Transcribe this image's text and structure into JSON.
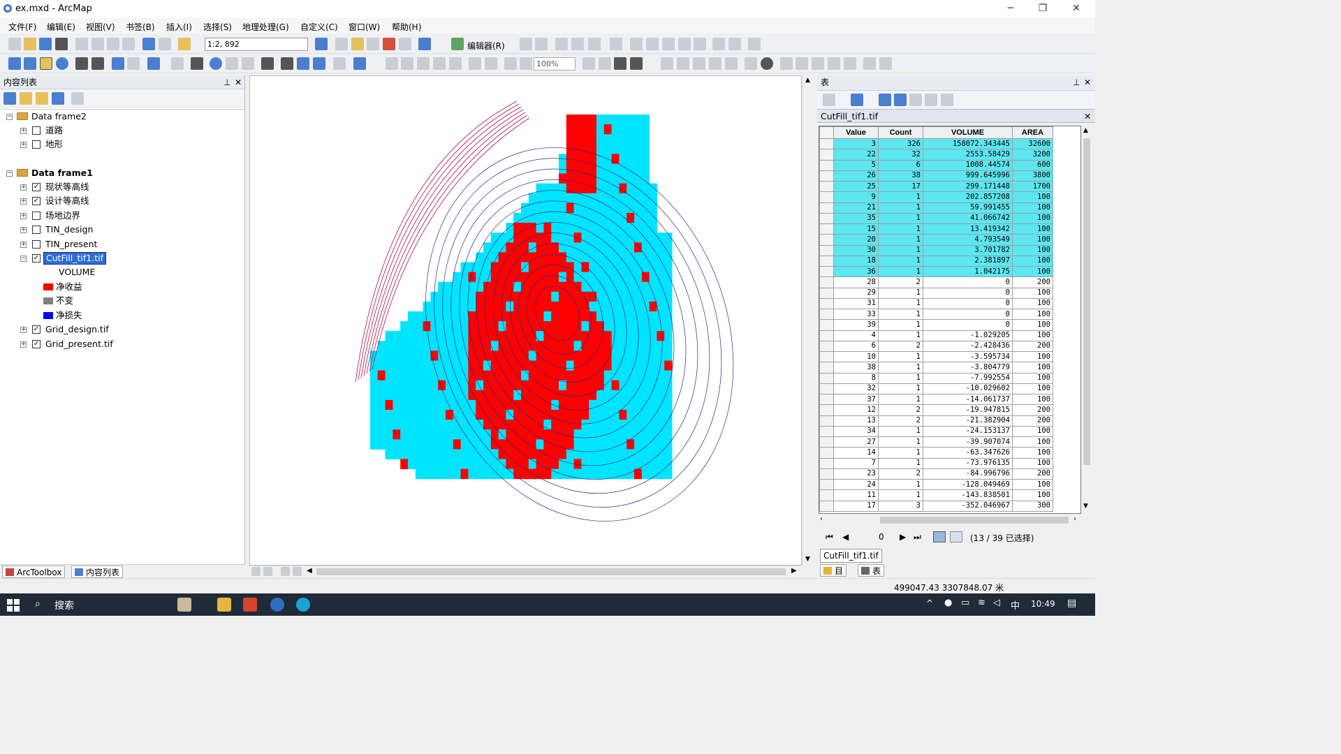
{
  "window": {
    "title": "ex.mxd - ArcMap",
    "controls": [
      "─",
      "❐",
      "✕"
    ]
  },
  "menu": [
    "文件(F)",
    "编辑(E)",
    "视图(V)",
    "书签(B)",
    "插入(I)",
    "选择(S)",
    "地理处理(G)",
    "自定义(C)",
    "窗口(W)",
    "帮助(H)"
  ],
  "toolbar": {
    "scale": "1:2, 892",
    "editor": "编辑器(R)",
    "zoom": "100%"
  },
  "toc": {
    "title": "内容列表",
    "frames": [
      {
        "name": "Data frame2",
        "layers": [
          {
            "name": "道路",
            "checked": false
          },
          {
            "name": "地形",
            "checked": false
          }
        ]
      },
      {
        "name": "Data frame1",
        "layers": [
          {
            "name": "现状等高线",
            "checked": true
          },
          {
            "name": "设计等高线",
            "checked": true
          },
          {
            "name": "场地边界",
            "checked": false
          },
          {
            "name": "TIN_design",
            "checked": false
          },
          {
            "name": "TIN_present",
            "checked": false
          },
          {
            "name": "CutFill_tif1.tif",
            "checked": true,
            "selected": true
          },
          {
            "name": "Grid_design.tif",
            "checked": true
          },
          {
            "name": "Grid_present.tif",
            "checked": true
          }
        ]
      }
    ],
    "legend": {
      "field": "VOLUME",
      "items": [
        {
          "label": "净收益",
          "color": "#ff0000"
        },
        {
          "label": "不变",
          "color": "#808080"
        },
        {
          "label": "净损失",
          "color": "#0000ff"
        }
      ]
    },
    "tabs": [
      "ArcToolbox",
      "内容列表"
    ]
  },
  "table": {
    "title": "表",
    "tab": "CutFill_tif1.tif",
    "columns": [
      "Value",
      "Count",
      "VOLUME",
      "AREA"
    ],
    "rows": [
      [
        "3",
        "326",
        "158072.343445",
        "32600"
      ],
      [
        "22",
        "32",
        "2553.58429",
        "3200"
      ],
      [
        "5",
        "6",
        "1008.44574",
        "600"
      ],
      [
        "26",
        "38",
        "999.645996",
        "3800"
      ],
      [
        "25",
        "17",
        "299.171448",
        "1700"
      ],
      [
        "9",
        "1",
        "202.857208",
        "100"
      ],
      [
        "21",
        "1",
        "59.991455",
        "100"
      ],
      [
        "35",
        "1",
        "41.066742",
        "100"
      ],
      [
        "15",
        "1",
        "13.419342",
        "100"
      ],
      [
        "20",
        "1",
        "4.793549",
        "100"
      ],
      [
        "30",
        "1",
        "3.701782",
        "100"
      ],
      [
        "18",
        "1",
        "2.381897",
        "100"
      ],
      [
        "36",
        "1",
        "1.042175",
        "100"
      ],
      [
        "28",
        "2",
        "0",
        "200"
      ],
      [
        "29",
        "1",
        "0",
        "100"
      ],
      [
        "31",
        "1",
        "0",
        "100"
      ],
      [
        "33",
        "1",
        "0",
        "100"
      ],
      [
        "39",
        "1",
        "0",
        "100"
      ],
      [
        "4",
        "1",
        "-1.029205",
        "100"
      ],
      [
        "6",
        "2",
        "-2.428436",
        "200"
      ],
      [
        "10",
        "1",
        "-3.595734",
        "100"
      ],
      [
        "38",
        "1",
        "-3.804779",
        "100"
      ],
      [
        "8",
        "1",
        "-7.992554",
        "100"
      ],
      [
        "32",
        "1",
        "-10.029602",
        "100"
      ],
      [
        "37",
        "1",
        "-14.061737",
        "100"
      ],
      [
        "12",
        "2",
        "-19.947815",
        "200"
      ],
      [
        "13",
        "2",
        "-21.382904",
        "200"
      ],
      [
        "34",
        "1",
        "-24.153137",
        "100"
      ],
      [
        "27",
        "1",
        "-39.907074",
        "100"
      ],
      [
        "14",
        "1",
        "-63.347626",
        "100"
      ],
      [
        "7",
        "1",
        "-73.976135",
        "100"
      ],
      [
        "23",
        "2",
        "-84.996796",
        "200"
      ],
      [
        "24",
        "1",
        "-128.049469",
        "100"
      ],
      [
        "11",
        "1",
        "-143.838501",
        "100"
      ],
      [
        "17",
        "3",
        "-352.046967",
        "300"
      ]
    ],
    "selected_count": 13,
    "record": "0",
    "selection_text": "(13 / 39 已选择)",
    "bottom_tab": "CutFill_tif1.tif",
    "bottom_buttons": [
      "目录",
      "表"
    ]
  },
  "status": {
    "coords": "499047.43  3307848.07 米"
  },
  "taskbar": {
    "search": "搜索",
    "ime": "中",
    "time": "10:49"
  },
  "map_colors": {
    "cut": "#ff0000",
    "fill": "#00e5ff",
    "contour_blue": "#2a2a8a",
    "contour_red": "#b01040"
  }
}
